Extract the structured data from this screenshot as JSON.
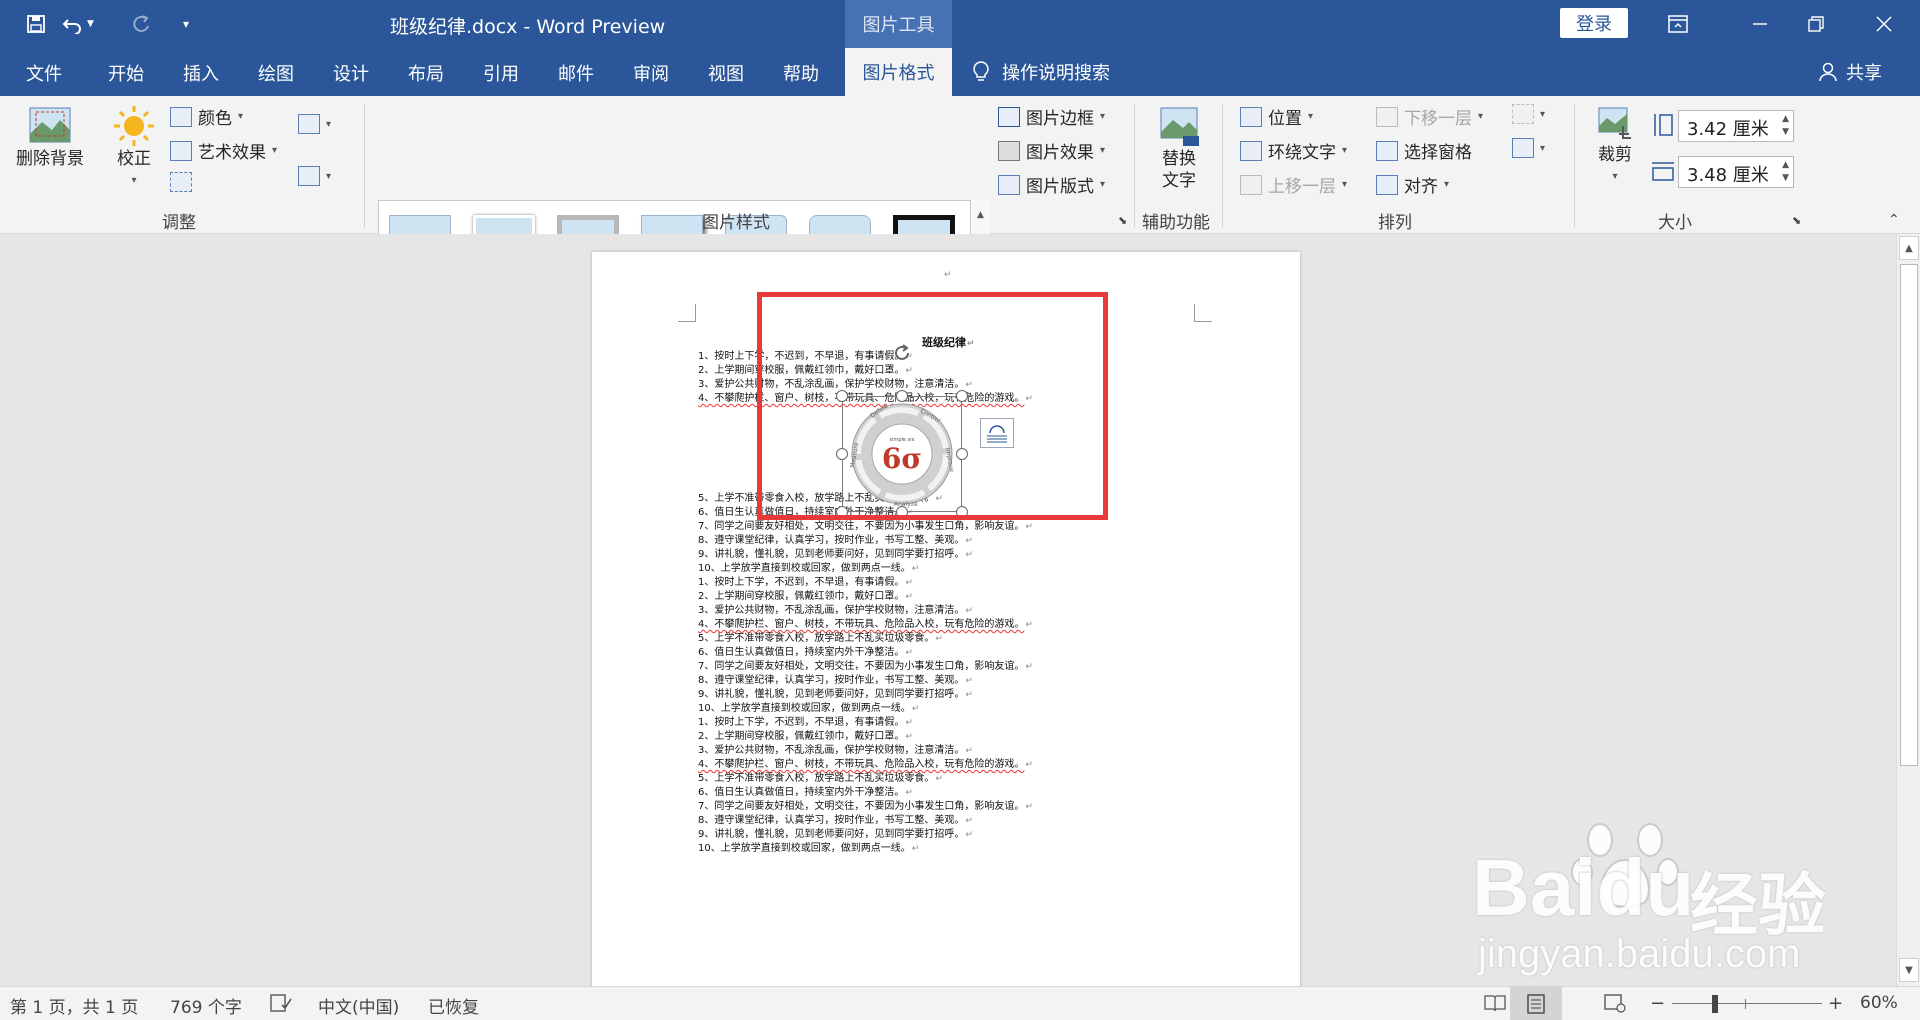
{
  "titlebar": {
    "document_title": "班级纪律.docx  -  Word Preview",
    "context_title": "图片工具",
    "login_label": "登录",
    "save_icon": "save-icon",
    "undo_icon": "undo-icon",
    "redo_icon": "redo-icon",
    "customize_icon": "customize-qat-icon"
  },
  "tabs": {
    "items": [
      "文件",
      "开始",
      "插入",
      "绘图",
      "设计",
      "布局",
      "引用",
      "邮件",
      "审阅",
      "视图",
      "帮助"
    ],
    "active": "图片格式",
    "tell_me": "操作说明搜索",
    "share": "共享"
  },
  "ribbon": {
    "adjust": {
      "remove_bg": "删除背景",
      "corrections": "校正",
      "color": "颜色",
      "artistic": "艺术效果",
      "label": "调整"
    },
    "styles": {
      "border": "图片边框",
      "effects": "图片效果",
      "layout": "图片版式",
      "label": "图片样式"
    },
    "accessibility": {
      "alt_text_line1": "替换",
      "alt_text_line2": "文字",
      "label": "辅助功能"
    },
    "arrange": {
      "position": "位置",
      "wrap_text": "环绕文字",
      "bring_forward": "上移一层",
      "send_backward": "下移一层",
      "selection_pane": "选择窗格",
      "align": "对齐",
      "label": "排列"
    },
    "size": {
      "crop": "裁剪",
      "height": "3.42 厘米",
      "width": "3.48 厘米",
      "label": "大小"
    }
  },
  "document": {
    "heading": "班级纪律",
    "paragraphs": [
      "1、按时上下学，不迟到，不早退，有事请假。",
      "2、上学期间穿校服，佩戴红领巾，戴好口罩。",
      "3、爱护公共财物，不乱涂乱画，保护学校财物，注意清洁。",
      "4、不攀爬护栏、窗户、树枝，不带玩具、危险品入校，玩有危险的游戏。",
      "5、上学不准带零食入校，放学路上不乱买垃圾零食。",
      "6、值日生认真做值日，持续室内外干净整洁。",
      "7、同学之间要友好相处，文明交往，不要因为小事发生口角，影响友谊。",
      "8、遵守课堂纪律，认真学习，按时作业，书写工整、美观。",
      "9、讲礼貌，懂礼貌，见到老师要问好，见到同学要打招呼。",
      "10、上学放学直接到校或回家，做到两点一线。"
    ],
    "image_text": {
      "center": "6σ",
      "top_small": "simple six",
      "ring": [
        "Define",
        "Control",
        "Improve",
        "Analyze",
        "Measure"
      ]
    }
  },
  "statusbar": {
    "page": "第 1 页，共 1 页",
    "words": "769 个字",
    "language": "中文(中国)",
    "status": "已恢复",
    "zoom": "60%"
  },
  "watermark": {
    "brand": "Baidu",
    "brand_cn": "经验",
    "url": "jingyan.baidu.com"
  }
}
